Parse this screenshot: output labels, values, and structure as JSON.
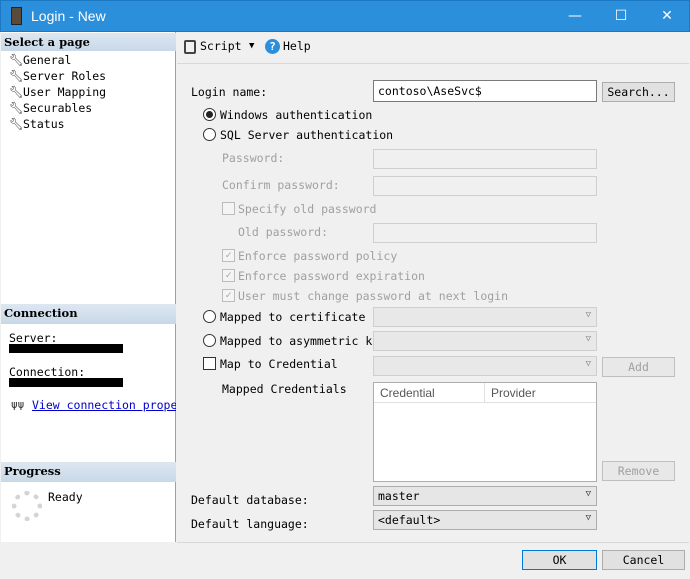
{
  "window": {
    "title": "Login - New",
    "accent": "#2b8fdc"
  },
  "sidebar": {
    "header": "Select a page",
    "items": [
      {
        "label": "General"
      },
      {
        "label": "Server Roles"
      },
      {
        "label": "User Mapping"
      },
      {
        "label": "Securables"
      },
      {
        "label": "Status"
      }
    ]
  },
  "connection": {
    "header": "Connection",
    "server_label": "Server:",
    "connection_label": "Connection:",
    "view_link": "View connection properti"
  },
  "progress": {
    "header": "Progress",
    "status": "Ready"
  },
  "toolbar": {
    "script": "Script",
    "help": "Help"
  },
  "form": {
    "login_name_label": "Login name:",
    "login_name_value": "contoso\\AseSvc$",
    "search": "Search...",
    "windows_auth": "Windows authentication",
    "sql_auth": "SQL Server authentication",
    "password": "Password:",
    "confirm_password": "Confirm password:",
    "specify_old": "Specify old password",
    "old_password": "Old password:",
    "enforce_policy": "Enforce password policy",
    "enforce_expiration": "Enforce password expiration",
    "must_change": "User must change password at next login",
    "mapped_cert": "Mapped to certificate",
    "mapped_asym": "Mapped to asymmetric key",
    "map_credential": "Map to Credential",
    "add": "Add",
    "mapped_credentials": "Mapped Credentials",
    "col_credential": "Credential",
    "col_provider": "Provider",
    "remove": "Remove",
    "default_db_label": "Default database:",
    "default_db": "master",
    "default_lang_label": "Default language:",
    "default_lang": "<default>"
  },
  "footer": {
    "ok": "OK",
    "cancel": "Cancel"
  }
}
